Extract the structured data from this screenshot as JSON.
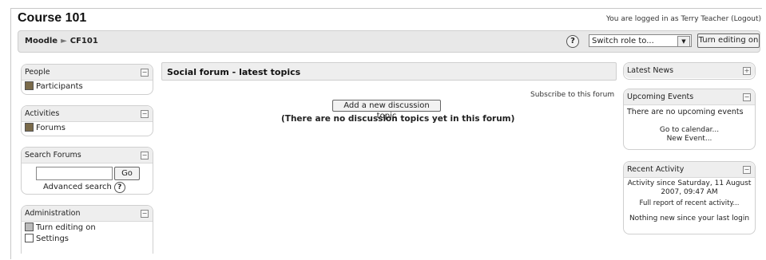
{
  "header": {
    "site_title": "Course 101",
    "login_info": "You are logged in as Terry Teacher (Logout)"
  },
  "navbar": {
    "breadcrumb_home": "Moodle",
    "breadcrumb_separator": "►",
    "breadcrumb_course": "CF101",
    "help_icon": "?",
    "role_select_value": "Switch role to...",
    "turn_editing_label": "Turn editing on"
  },
  "left": {
    "people": {
      "title": "People",
      "items": [
        {
          "label": "Participants",
          "icon": "participants-icon"
        }
      ]
    },
    "activities": {
      "title": "Activities",
      "items": [
        {
          "label": "Forums",
          "icon": "forums-icon"
        }
      ]
    },
    "search": {
      "title": "Search Forums",
      "go_label": "Go",
      "advanced_label": "Advanced search",
      "help_icon": "?"
    },
    "admin": {
      "title": "Administration",
      "items": [
        {
          "label": "Turn editing on",
          "icon": "edit-icon"
        },
        {
          "label": "Settings",
          "icon": "settings-icon"
        }
      ]
    }
  },
  "center": {
    "title": "Social forum - latest topics",
    "subscribe_label": "Subscribe to this forum",
    "add_topic_label": "Add a new discussion topic",
    "no_topics_text": "(There are no discussion topics yet in this forum)"
  },
  "right": {
    "latest_news": {
      "title": "Latest News",
      "toggle": "+"
    },
    "upcoming": {
      "title": "Upcoming Events",
      "none_text": "There are no upcoming events",
      "calendar_link": "Go to calendar...",
      "new_event_link": "New Event..."
    },
    "recent": {
      "title": "Recent Activity",
      "since_text": "Activity since Saturday, 11 August 2007, 09:47 AM",
      "full_report_link": "Full report of recent activity...",
      "nothing_text": "Nothing new since your last login"
    }
  },
  "toggles": {
    "minus": "−"
  }
}
